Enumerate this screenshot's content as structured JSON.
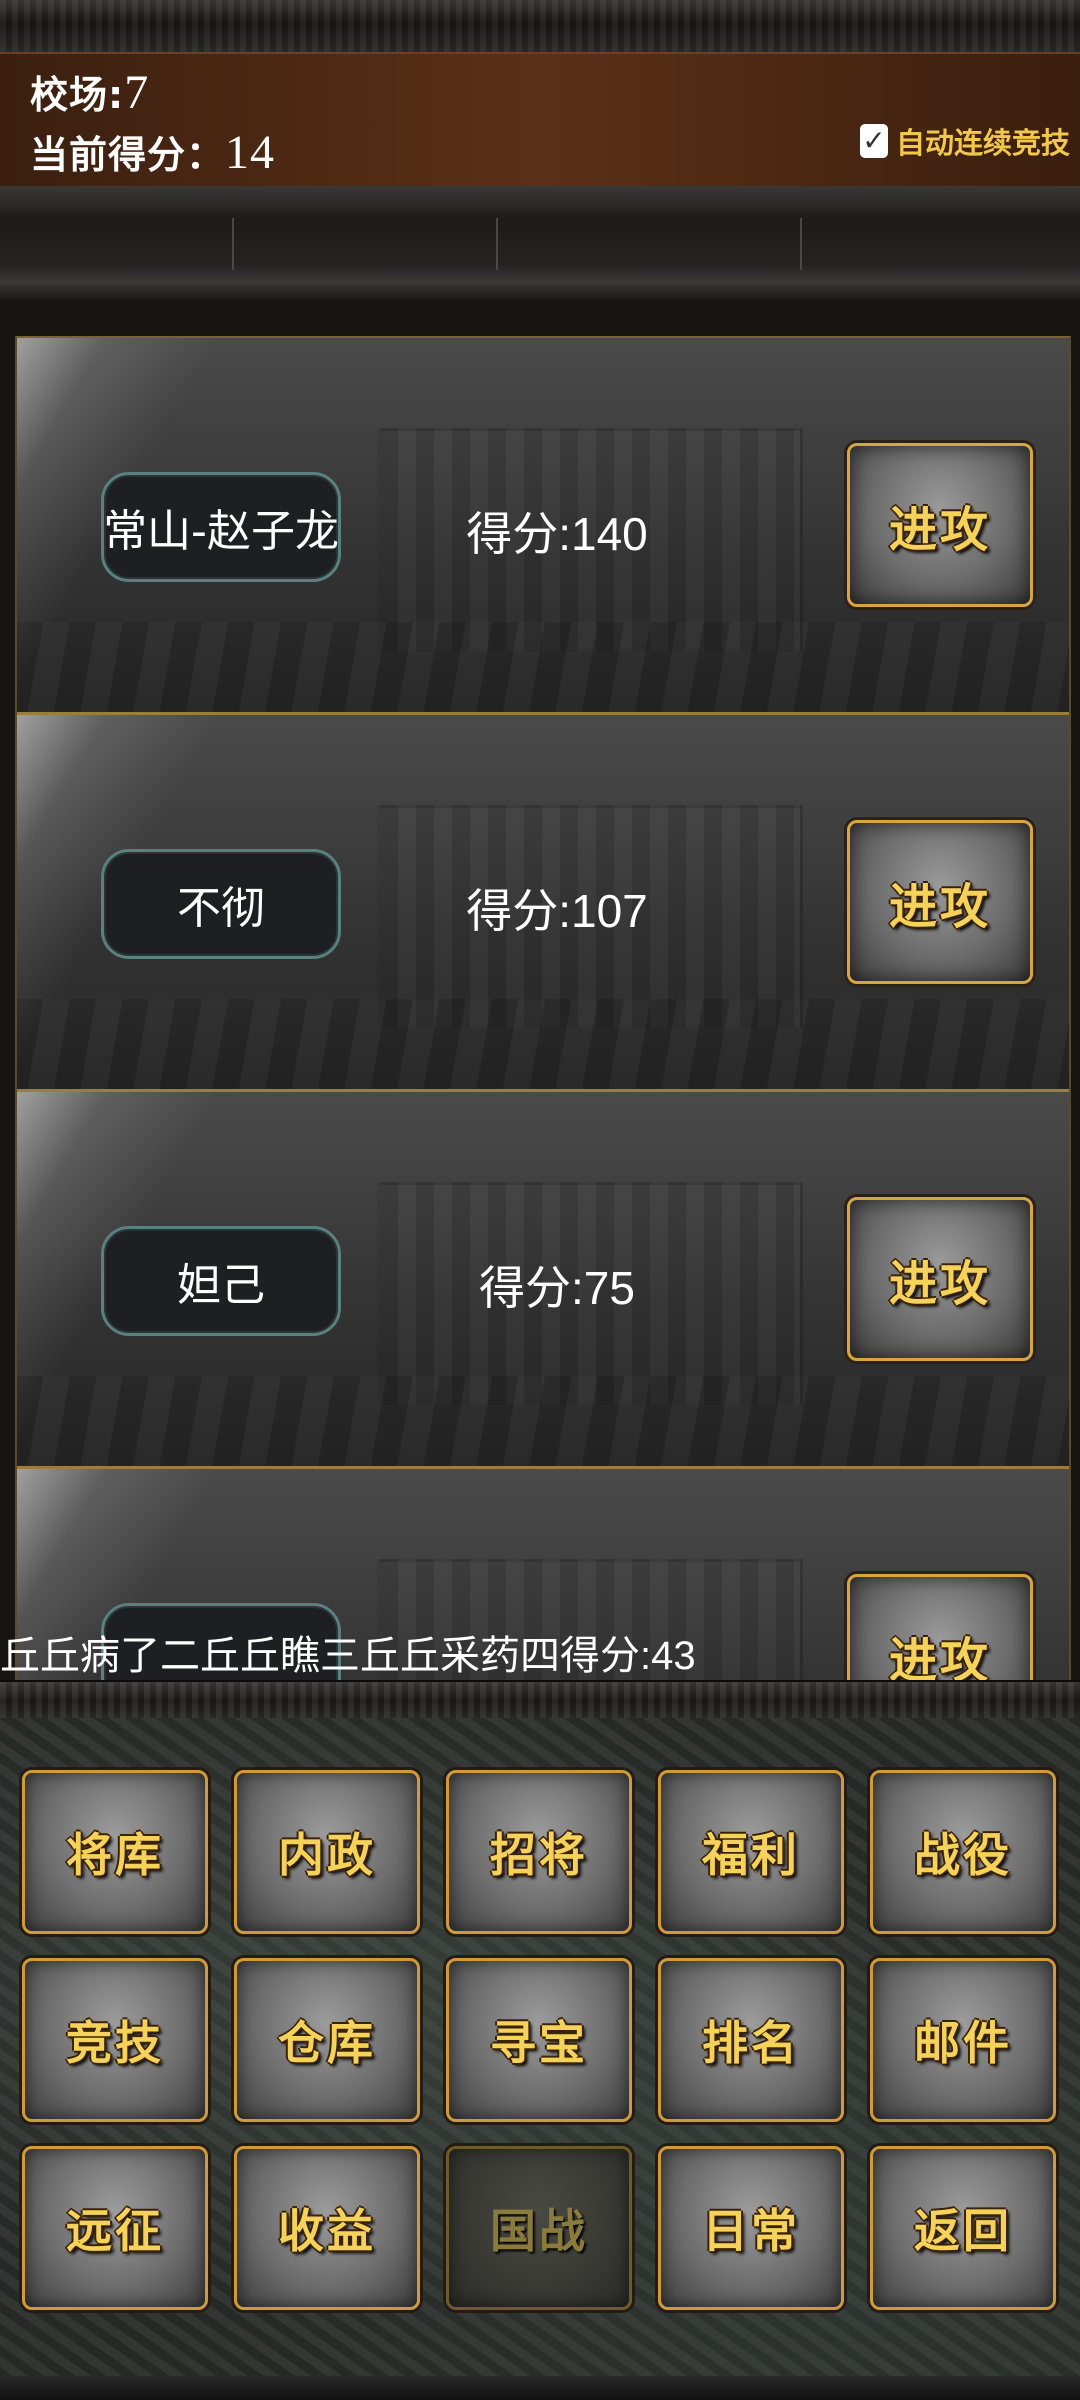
{
  "header": {
    "arena_label": "校场:",
    "arena_value": "7",
    "score_label": "当前得分：",
    "score_value": "14",
    "auto_checked_mark": "✓",
    "auto_label": "自动连续竞技"
  },
  "opponents": [
    {
      "name": "常山-赵子龙",
      "score": "得分:140",
      "action": "进攻"
    },
    {
      "name": "不彻",
      "score": "得分:107",
      "action": "进攻"
    },
    {
      "name": "妲己",
      "score": "得分:75",
      "action": "进攻"
    },
    {
      "name": "",
      "score": "",
      "action": "进攻"
    }
  ],
  "ticker": "丘丘病了二丘丘瞧三丘丘采药四得分:43",
  "menu": {
    "row1": [
      "将库",
      "内政",
      "招将",
      "福利",
      "战役"
    ],
    "row2": [
      "竞技",
      "仓库",
      "寻宝",
      "排名",
      "邮件"
    ],
    "row3": [
      "远征",
      "收益",
      "国战",
      "日常",
      "返回"
    ]
  },
  "icons": {
    "checkbox": "checkmark-icon"
  },
  "colors": {
    "accent_gold": "#f5d25a",
    "header_brown": "#5b3018",
    "pill_border": "#5b8080"
  }
}
